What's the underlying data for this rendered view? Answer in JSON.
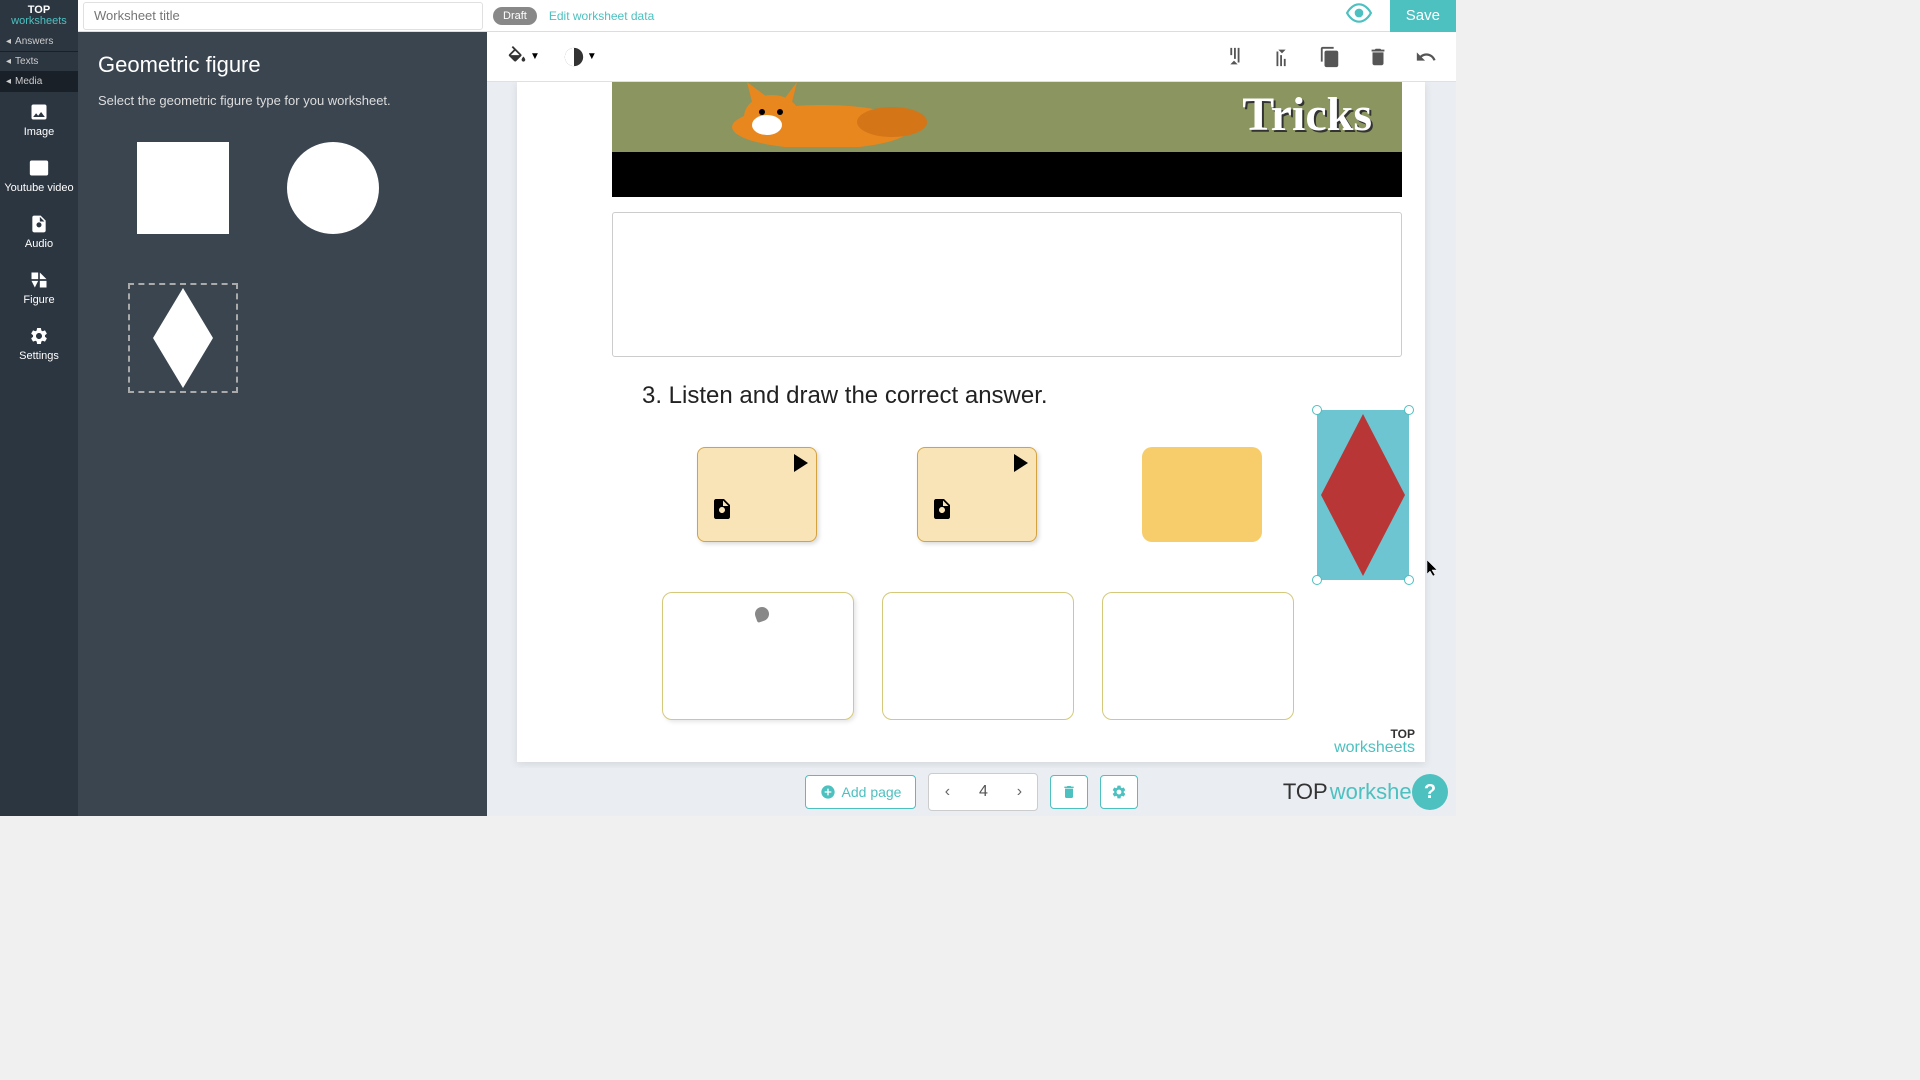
{
  "header": {
    "logo_top": "TOP",
    "logo_bot": "worksheets",
    "title_placeholder": "Worksheet title",
    "draft": "Draft",
    "edit_link": "Edit worksheet data",
    "save": "Save"
  },
  "sidebar": {
    "answers": "Answers",
    "texts": "Texts",
    "media": "Media",
    "image": "Image",
    "youtube": "Youtube video",
    "audio": "Audio",
    "figure": "Figure",
    "settings": "Settings"
  },
  "panel": {
    "title": "Geometric figure",
    "desc": "Select the geometric figure type for you worksheet."
  },
  "canvas": {
    "banner_text": "Tricks",
    "question": "3. Listen and draw the correct answer.",
    "watermark_top": "TOP",
    "watermark_bot": "worksheets"
  },
  "controls": {
    "add_page": "Add page",
    "page_number": "4",
    "footer_top": "TOP",
    "footer_ws": "worksheets",
    "help": "?"
  },
  "colors": {
    "teal": "#4dc0c0",
    "dark": "#2c3640",
    "diamond_fill": "#b93636",
    "diamond_bg": "#6cc5d0"
  }
}
